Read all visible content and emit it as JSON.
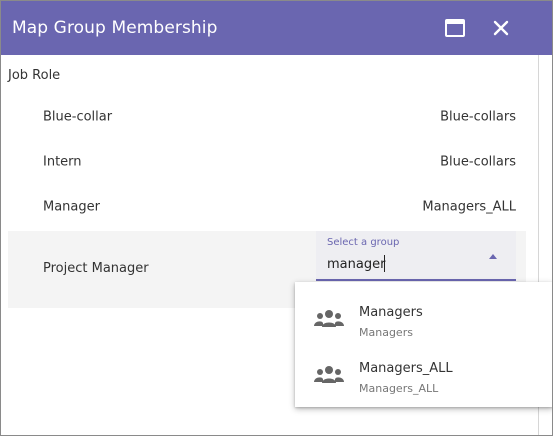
{
  "dialog": {
    "title": "Map Group Membership",
    "colors": {
      "titlebar": "#6a66b0",
      "accent": "#6a66b0",
      "active_row": "#f4f4f4"
    },
    "buttons": {
      "maximize_icon": "maximize-icon",
      "close_icon": "close-icon"
    }
  },
  "section": {
    "label": "Job Role"
  },
  "rows": [
    {
      "role": "Blue-collar",
      "group": "Blue-collars"
    },
    {
      "role": "Intern",
      "group": "Blue-collars"
    },
    {
      "role": "Manager",
      "group": "Managers_ALL"
    },
    {
      "role": "Project Manager",
      "group": ""
    }
  ],
  "select": {
    "label": "Select a group",
    "value": "manager",
    "arrow_icon": "arrow-up-icon"
  },
  "dropdown": {
    "options": [
      {
        "primary": "Managers",
        "secondary": "Managers",
        "icon": "group-icon"
      },
      {
        "primary": "Managers_ALL",
        "secondary": "Managers_ALL",
        "icon": "group-icon"
      }
    ]
  }
}
